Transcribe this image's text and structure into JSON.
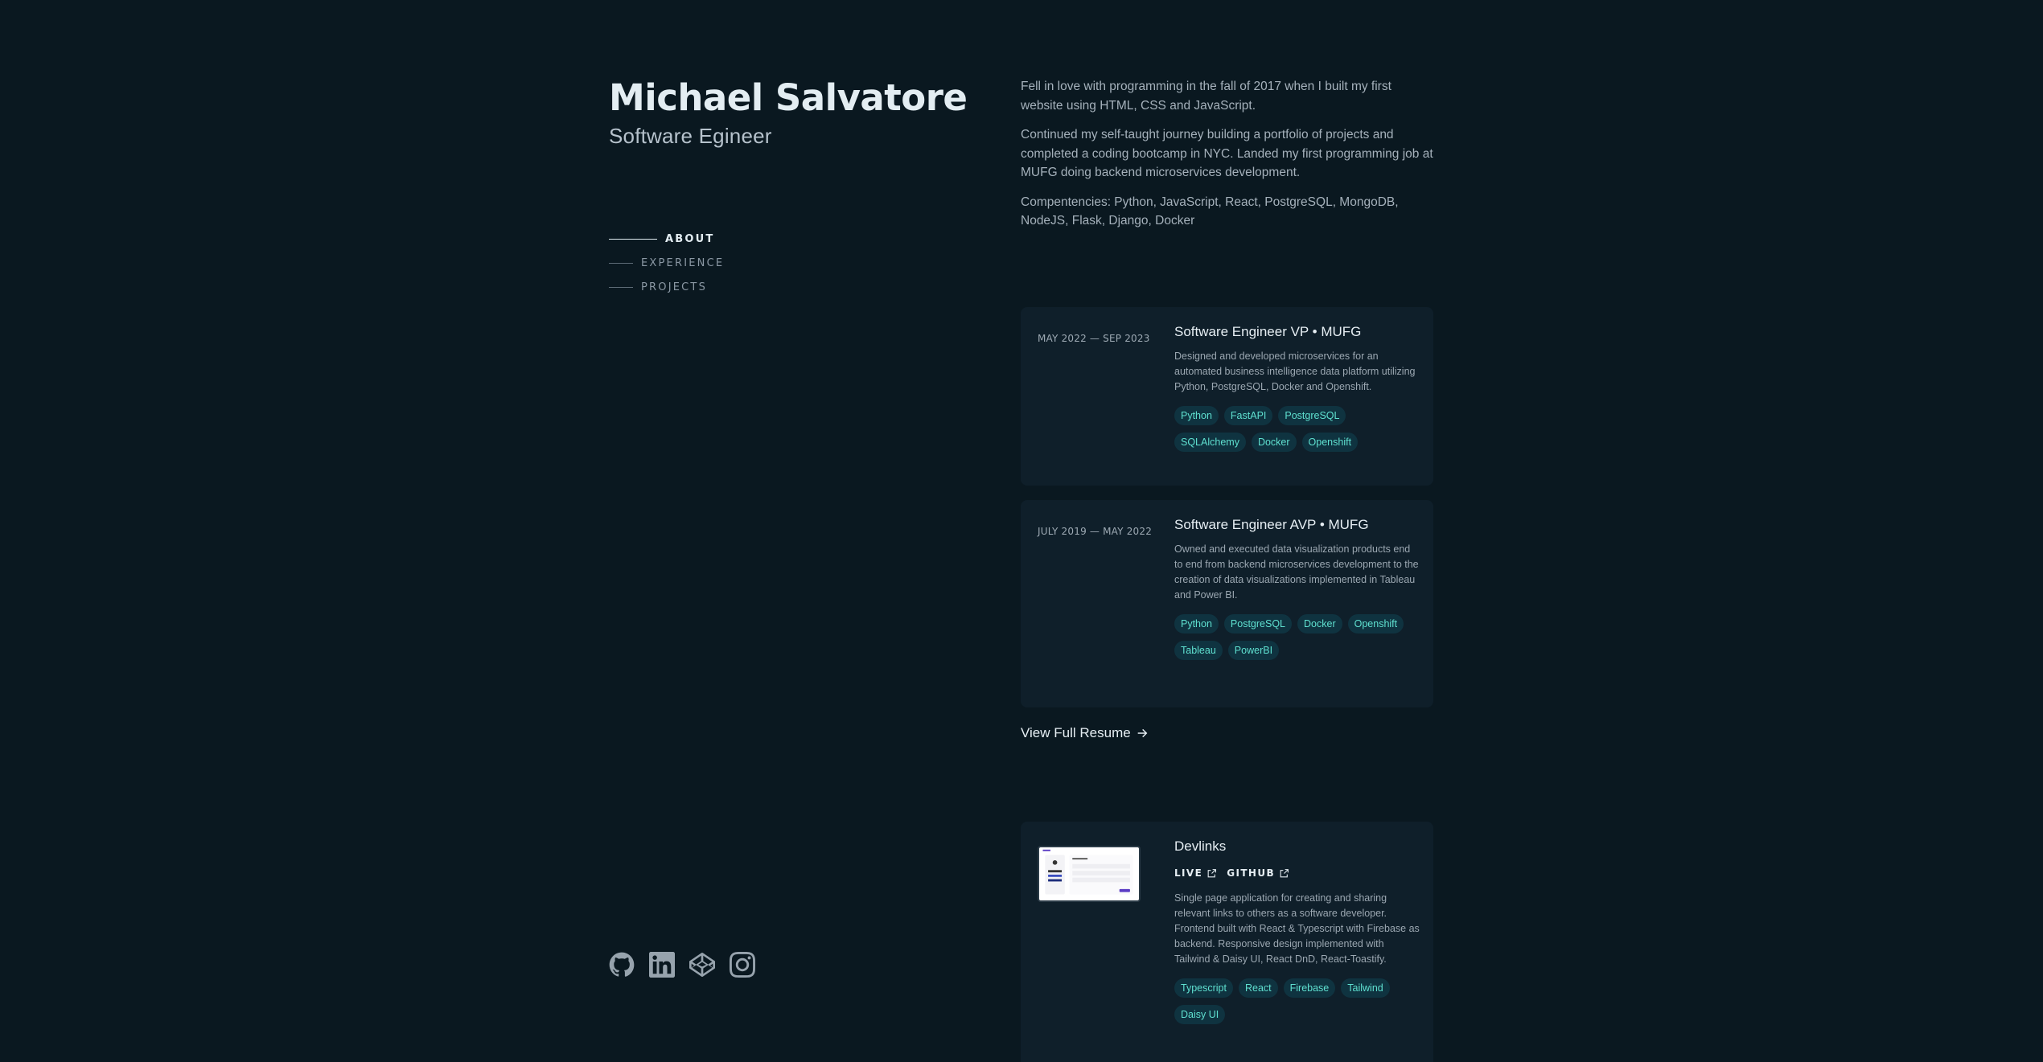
{
  "profile": {
    "name": "Michael Salvatore",
    "role": "Software Egineer"
  },
  "nav": {
    "items": [
      {
        "label": "ABOUT",
        "active": true
      },
      {
        "label": "EXPERIENCE",
        "active": false
      },
      {
        "label": "PROJECTS",
        "active": false
      }
    ]
  },
  "about": {
    "paragraphs": [
      "Fell in love with programming in the fall of 2017 when I built my first website using HTML, CSS and JavaScript.",
      "Continued my self-taught journey building a portfolio of projects and completed a coding bootcamp in NYC. Landed my first programming job at MUFG doing backend microservices development.",
      "Compentencies: Python, JavaScript, React, PostgreSQL, MongoDB, NodeJS, Flask, Django, Docker"
    ]
  },
  "experience": [
    {
      "date": "MAY 2022 — SEP 2023",
      "title": "Software Engineer VP • MUFG",
      "description": "Designed and developed microservices for an automated business intelligence data platform utilizing Python, PostgreSQL, Docker and Openshift.",
      "tags": [
        "Python",
        "FastAPI",
        "PostgreSQL",
        "SQLAlchemy",
        "Docker",
        "Openshift"
      ]
    },
    {
      "date": "JULY 2019 — MAY 2022",
      "title": "Software Engineer AVP • MUFG",
      "description": "Owned and executed data visualization products end to end from backend microservices development to the creation of data visualizations implemented in Tableau and Power BI.",
      "tags": [
        "Python",
        "PostgreSQL",
        "Docker",
        "Openshift",
        "Tableau",
        "PowerBI"
      ]
    }
  ],
  "resume_link": "View Full Resume",
  "projects": [
    {
      "title": "Devlinks",
      "live_label": "LIVE",
      "github_label": "GITHUB",
      "description": "Single page application for creating and sharing relevant links to others as a software developer. Frontend built with React & Typescript with Firebase as backend. Responsive design implemented with Tailwind & Daisy UI, React DnD, React-Toastify.",
      "tags": [
        "Typescript",
        "React",
        "Firebase",
        "Tailwind",
        "Daisy UI"
      ]
    }
  ],
  "socials": [
    {
      "icon": "github-icon"
    },
    {
      "icon": "linkedin-icon"
    },
    {
      "icon": "codepen-icon"
    },
    {
      "icon": "instagram-icon"
    }
  ],
  "colors": {
    "background": "#0a1820",
    "card": "#0f1f2a",
    "tag_text": "#5fe0d0",
    "tag_bg": "#0f3340",
    "heading": "#e3edf2"
  }
}
